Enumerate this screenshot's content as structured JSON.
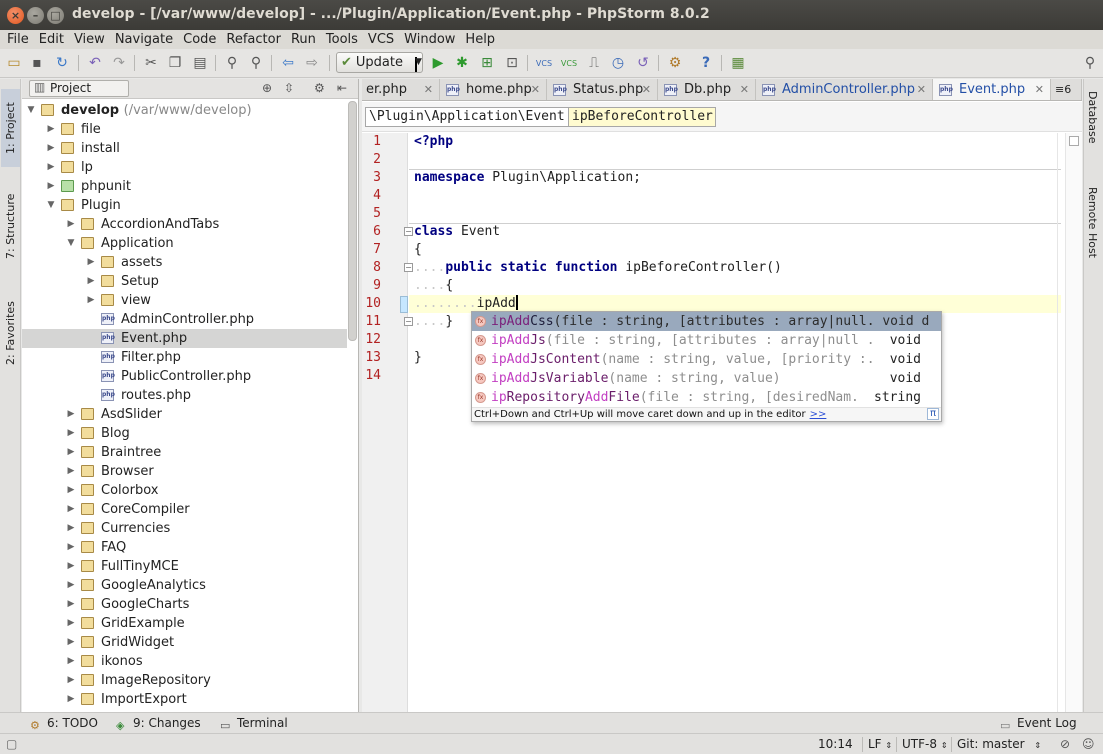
{
  "window": {
    "title": "develop - [/var/www/develop] - .../Plugin/Application/Event.php - PhpStorm 8.0.2"
  },
  "menu": [
    "File",
    "Edit",
    "View",
    "Navigate",
    "Code",
    "Refactor",
    "Run",
    "Tools",
    "VCS",
    "Window",
    "Help"
  ],
  "toolbar": {
    "update_label": "Update"
  },
  "left_tool_tabs": {
    "project": "1: Project",
    "structure": "7: Structure",
    "favorites": "2: Favorites"
  },
  "right_tool_tabs": {
    "database": "Database",
    "remote_host": "Remote Host"
  },
  "project_panel": {
    "view_selector": "Project",
    "root_name": "develop",
    "root_path": "(/var/www/develop)",
    "items": [
      {
        "label": "file",
        "type": "folder"
      },
      {
        "label": "install",
        "type": "folder"
      },
      {
        "label": "lp",
        "type": "folder"
      },
      {
        "label": "phpunit",
        "type": "folder"
      },
      {
        "label": "Plugin",
        "type": "folder"
      },
      {
        "label": "AccordionAndTabs",
        "type": "folder"
      },
      {
        "label": "Application",
        "type": "folder"
      },
      {
        "label": "assets",
        "type": "folder"
      },
      {
        "label": "Setup",
        "type": "folder"
      },
      {
        "label": "view",
        "type": "folder"
      },
      {
        "label": "AdminController.php",
        "type": "php"
      },
      {
        "label": "Event.php",
        "type": "php"
      },
      {
        "label": "Filter.php",
        "type": "php"
      },
      {
        "label": "PublicController.php",
        "type": "php"
      },
      {
        "label": "routes.php",
        "type": "php"
      },
      {
        "label": "AsdSlider",
        "type": "folder"
      },
      {
        "label": "Blog",
        "type": "folder"
      },
      {
        "label": "Braintree",
        "type": "folder"
      },
      {
        "label": "Browser",
        "type": "folder"
      },
      {
        "label": "Colorbox",
        "type": "folder"
      },
      {
        "label": "CoreCompiler",
        "type": "folder"
      },
      {
        "label": "Currencies",
        "type": "folder"
      },
      {
        "label": "FAQ",
        "type": "folder"
      },
      {
        "label": "FullTinyMCE",
        "type": "folder"
      },
      {
        "label": "GoogleAnalytics",
        "type": "folder"
      },
      {
        "label": "GoogleCharts",
        "type": "folder"
      },
      {
        "label": "GridExample",
        "type": "folder"
      },
      {
        "label": "GridWidget",
        "type": "folder"
      },
      {
        "label": "ikonos",
        "type": "folder"
      },
      {
        "label": "ImageRepository",
        "type": "folder"
      },
      {
        "label": "ImportExport",
        "type": "folder"
      }
    ]
  },
  "editor": {
    "tabs": [
      {
        "label": "er.php"
      },
      {
        "label": "home.php"
      },
      {
        "label": "Status.php"
      },
      {
        "label": "Db.php"
      },
      {
        "label": "AdminController.php"
      },
      {
        "label": "Event.php"
      }
    ],
    "tab_overflow": "≡6",
    "breadcrumbs": [
      "\\Plugin\\Application\\Event",
      "ipBeforeController"
    ],
    "line_numbers": [
      "1",
      "2",
      "3",
      "4",
      "5",
      "6",
      "7",
      "8",
      "9",
      "10",
      "11",
      "12",
      "13",
      "14"
    ],
    "code": {
      "l1": "<?php",
      "l3_kw": "namespace",
      "l3_rest": " Plugin\\Application;",
      "l6_kw": "class",
      "l6_rest": " Event",
      "l7": "{",
      "l8_dots": "....",
      "l8_kw": "public static function",
      "l8_rest": " ipBeforeController()",
      "l9_dots": "....",
      "l9_rest": "{",
      "l10_dots": "........",
      "l10_rest": "ipAdd",
      "l11_dots": "....",
      "l11_rest": "}",
      "l13": "}"
    }
  },
  "autocomplete": {
    "items": [
      {
        "match": "ipAdd",
        "rest": "Css",
        "params": "(file : string, [attributes : array|null. void d",
        "type": ""
      },
      {
        "match": "ipAdd",
        "rest": "Js",
        "params": "(file : string, [attributes : array|null .",
        "type": "void"
      },
      {
        "match": "ipAdd",
        "rest": "JsContent",
        "params": "(name : string, value, [priority :.",
        "type": "void"
      },
      {
        "match": "ipAdd",
        "rest": "JsVariable",
        "params": "(name : string, value)",
        "type": "void"
      },
      {
        "match_pre": "ip",
        "pre_rest": "Repository",
        "match": "Add",
        "rest": "File",
        "params": "(file : string, [desiredNam.",
        "type": "string"
      }
    ],
    "icon_label": "fx",
    "hint": "Ctrl+Down and Ctrl+Up will move caret down and up in the editor",
    "hint_link": ">>",
    "pi": "π"
  },
  "bottom_tools": {
    "todo": "6: TODO",
    "changes": "9: Changes",
    "terminal": "Terminal",
    "event_log": "Event Log"
  },
  "status": {
    "position": "10:14",
    "line_separator": "LF",
    "encoding": "UTF-8",
    "vcs_branch": "Git: master"
  },
  "colors": {
    "keyword": "#000080",
    "line_number": "#b22222",
    "current_line": "#ffffd7",
    "popup_selection": "#99a9bd",
    "match_highlight": "#c23ec2",
    "active_tab_text": "#234fa6"
  }
}
